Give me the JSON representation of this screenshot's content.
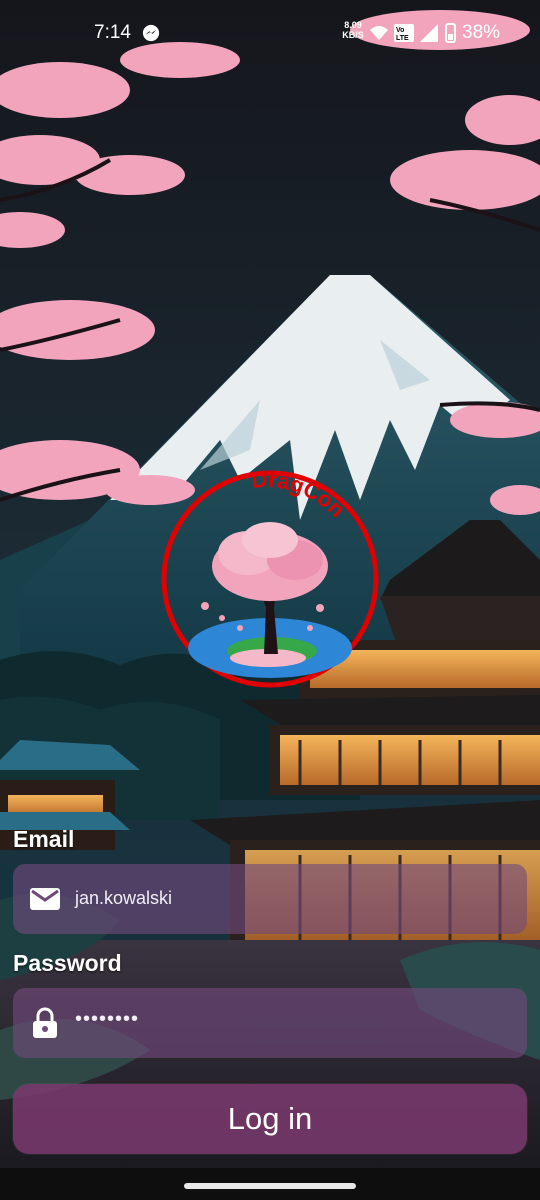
{
  "status_bar": {
    "time": "7:14",
    "network_speed": "8.09",
    "network_speed_unit": "KB/S",
    "volte": "Vo LTE",
    "battery": "38%"
  },
  "logo": {
    "text": "DragCon"
  },
  "login_form": {
    "email_label": "Email",
    "email_value": "jan.kowalski",
    "password_label": "Password",
    "password_value": "••••••••",
    "login_button_label": "Log in"
  },
  "colors": {
    "input_background": "#734b7d",
    "button_background": "#7b3a6e",
    "logo_ring": "#e00000",
    "sakura": "#f2a4bd"
  }
}
